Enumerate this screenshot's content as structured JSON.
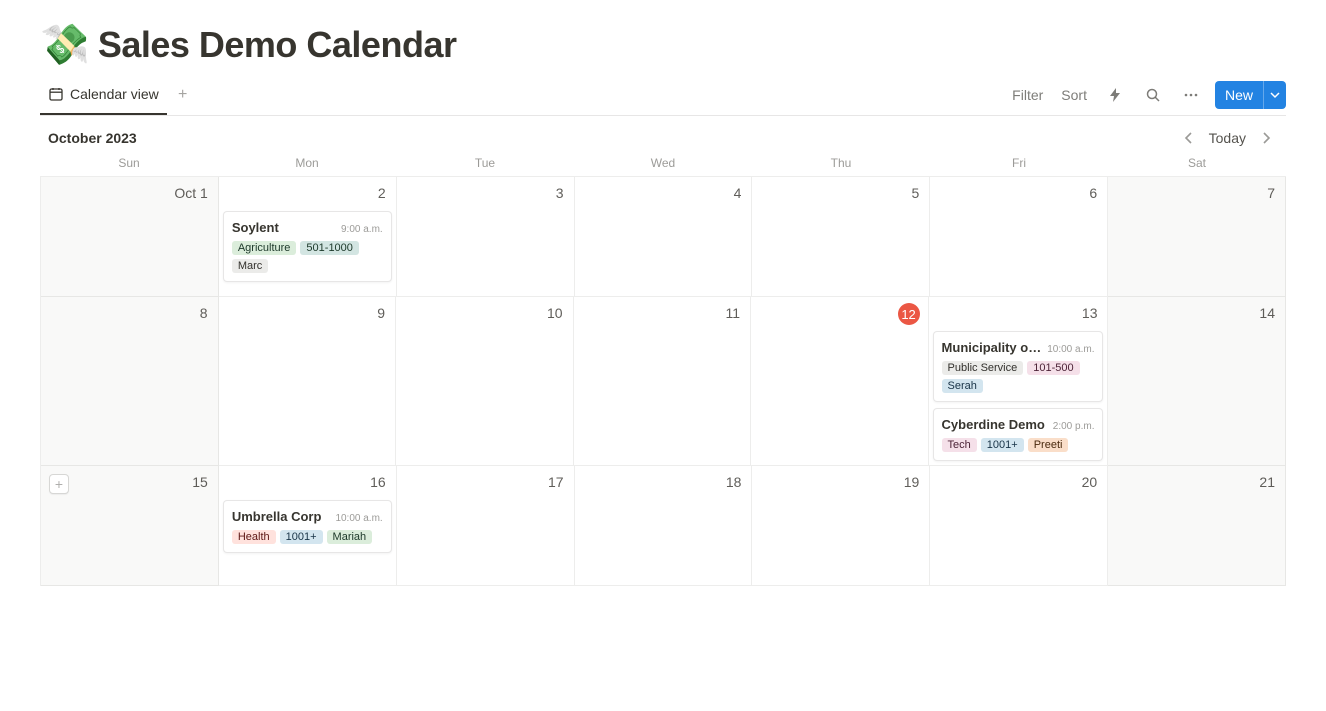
{
  "header": {
    "emoji": "💸",
    "title": "Sales Demo Calendar"
  },
  "toolbar": {
    "view_label": "Calendar view",
    "filter_label": "Filter",
    "sort_label": "Sort",
    "new_label": "New"
  },
  "month": {
    "label": "October 2023",
    "today_label": "Today"
  },
  "dow": [
    "Sun",
    "Mon",
    "Tue",
    "Wed",
    "Thu",
    "Fri",
    "Sat"
  ],
  "tag_colors": {
    "Agriculture": "green",
    "501-1000": "teal",
    "Marc": "gray",
    "Public Service": "gray",
    "101-500": "pink",
    "Serah": "blue",
    "Tech": "pink",
    "1001+": "blue",
    "Preeti": "orange",
    "Health": "red",
    "Mariah": "green"
  },
  "weeks": [
    {
      "days": [
        {
          "label": "Oct 1",
          "outside": true,
          "events": []
        },
        {
          "label": "2",
          "events": [
            {
              "title": "Soylent",
              "time": "9:00 a.m.",
              "tags": [
                "Agriculture",
                "501-1000",
                "Marc"
              ]
            }
          ]
        },
        {
          "label": "3",
          "events": []
        },
        {
          "label": "4",
          "events": []
        },
        {
          "label": "5",
          "events": []
        },
        {
          "label": "6",
          "events": []
        },
        {
          "label": "7",
          "outside": true,
          "events": []
        }
      ]
    },
    {
      "days": [
        {
          "label": "8",
          "outside": true,
          "events": []
        },
        {
          "label": "9",
          "events": []
        },
        {
          "label": "10",
          "events": []
        },
        {
          "label": "11",
          "events": []
        },
        {
          "label": "12",
          "today": true,
          "events": []
        },
        {
          "label": "13",
          "events": [
            {
              "title": "Municipality o…",
              "time": "10:00 a.m.",
              "tags": [
                "Public Service",
                "101-500",
                "Serah"
              ]
            },
            {
              "title": "Cyberdine Demo",
              "time": "2:00 p.m.",
              "tags": [
                "Tech",
                "1001+",
                "Preeti"
              ]
            }
          ]
        },
        {
          "label": "14",
          "outside": true,
          "events": []
        }
      ]
    },
    {
      "days": [
        {
          "label": "15",
          "outside": true,
          "showPlus": true,
          "events": []
        },
        {
          "label": "16",
          "events": [
            {
              "title": "Umbrella Corp",
              "time": "10:00 a.m.",
              "tags": [
                "Health",
                "1001+",
                "Mariah"
              ]
            }
          ]
        },
        {
          "label": "17",
          "events": []
        },
        {
          "label": "18",
          "events": []
        },
        {
          "label": "19",
          "events": []
        },
        {
          "label": "20",
          "events": []
        },
        {
          "label": "21",
          "outside": true,
          "events": []
        }
      ]
    }
  ]
}
